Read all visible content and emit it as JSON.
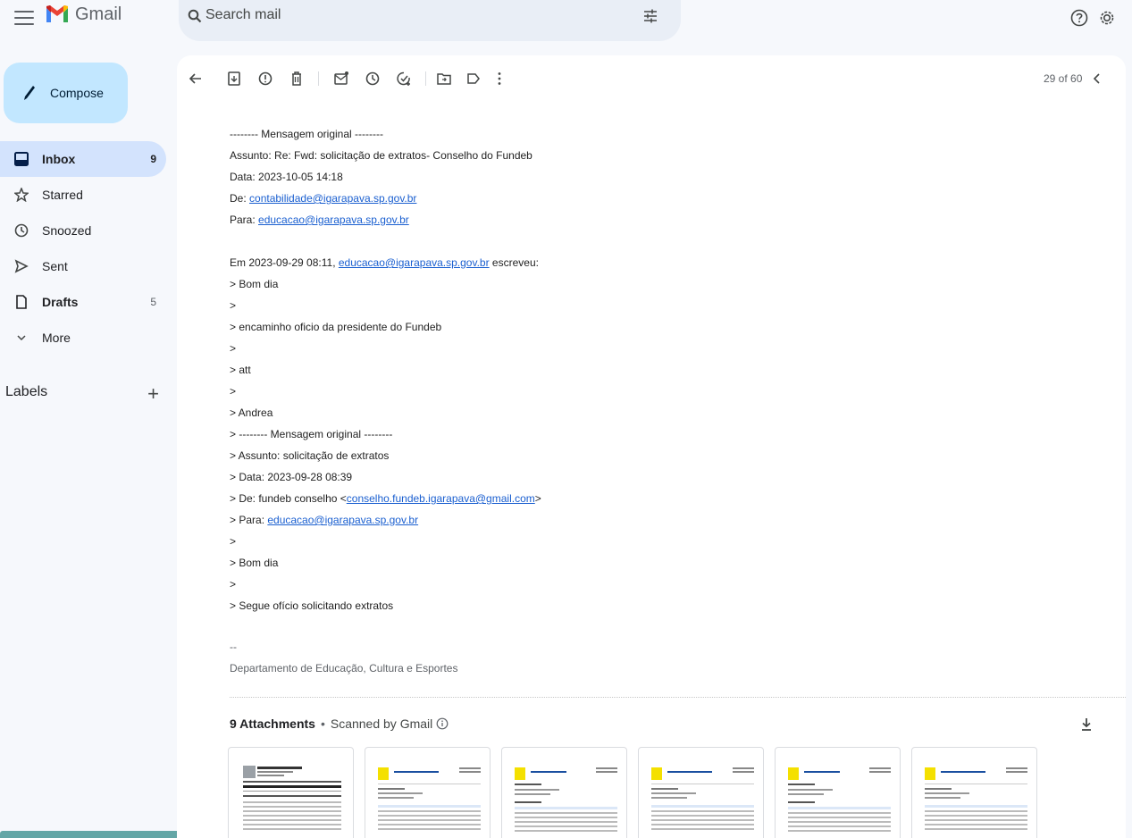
{
  "app": {
    "name": "Gmail"
  },
  "search": {
    "placeholder": "Search mail"
  },
  "compose": {
    "label": "Compose"
  },
  "sidebar": {
    "items": [
      {
        "label": "Inbox",
        "count": "9",
        "icon": "inbox-icon"
      },
      {
        "label": "Starred",
        "count": "",
        "icon": "star-icon"
      },
      {
        "label": "Snoozed",
        "count": "",
        "icon": "clock-icon"
      },
      {
        "label": "Sent",
        "count": "",
        "icon": "send-icon"
      },
      {
        "label": "Drafts",
        "count": "5",
        "icon": "draft-icon"
      },
      {
        "label": "More",
        "count": "",
        "icon": "chevron-down-icon"
      }
    ],
    "labels_title": "Labels",
    "labels_add": "+"
  },
  "toolbar": {
    "pager": "29 of 60"
  },
  "email": {
    "original_header": "-------- Mensagem original --------",
    "assunto": "Assunto: Re: Fwd: solicitação de extratos- Conselho do Fundeb",
    "data": "Data: 2023-10-05 14:18",
    "de_prefix": "De: ",
    "de_email": "contabilidade@igarapava.sp.gov.br",
    "para_prefix": "Para: ",
    "para_email": "educacao@igarapava.sp.gov.br",
    "em_prefix": "Em 2023-09-29 08:11, ",
    "em_email": "educacao@igarapava.sp.gov.br",
    "em_suffix": " escreveu:",
    "q1": "> Bom dia",
    "q2": ">",
    "q3": "> encaminho oficio da presidente do Fundeb",
    "q4": ">",
    "q5": "> att",
    "q6": ">",
    "q7": "> Andrea",
    "q8": "> -------- Mensagem original --------",
    "q9": "> Assunto: solicitação de extratos",
    "q10": "> Data: 2023-09-28 08:39",
    "q11_prefix": "> De: fundeb conselho <",
    "q11_email": "conselho.fundeb.igarapava@gmail.com",
    "q11_suffix": ">",
    "q12_prefix": "> Para: ",
    "q12_email": "educacao@igarapava.sp.gov.br",
    "q13": ">",
    "q14": "> Bom dia",
    "q15": ">",
    "q16": "> Segue ofício solicitando extratos",
    "sig_dash": "--",
    "sig_dept": "Departamento de Educação, Cultura e Esportes"
  },
  "attachments": {
    "count_label": "9 Attachments",
    "dot": "•",
    "scan_label": "Scanned by Gmail"
  },
  "colors": {
    "accent": "#c2e7ff",
    "active_nav": "#d3e3fd",
    "link": "#1a5fd0",
    "background": "#f6f8fc"
  }
}
